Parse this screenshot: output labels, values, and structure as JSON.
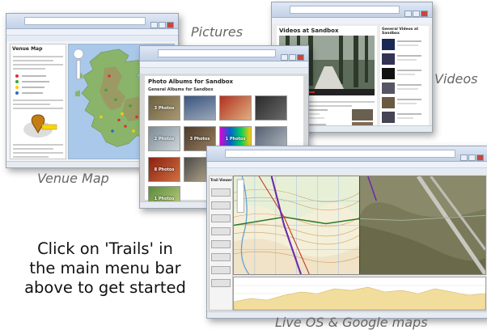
{
  "captions": {
    "pictures": "Pictures",
    "videos": "Videos",
    "venue_map": "Venue Map",
    "live_maps": "Live OS & Google maps"
  },
  "call_to_action": {
    "line1": "Click on 'Trails' in",
    "line2": "the main menu bar",
    "line3": "above to get started"
  },
  "screens": {
    "venue": {
      "panel_title": "Venue Map"
    },
    "pictures": {
      "title": "Photo Albums for Sandbox",
      "subtitle": "General Albums for Sandbox",
      "thumbs": [
        "3 Photos",
        "",
        "",
        "",
        "2 Photos",
        "3 Photos",
        "1 Photos",
        "",
        "8 Photos",
        "",
        "1 Photos"
      ]
    },
    "videos": {
      "title": "Videos at Sandbox",
      "side_title": "General Videos at Sandbox"
    },
    "live": {
      "panel_title": "Trail Viewer"
    }
  }
}
